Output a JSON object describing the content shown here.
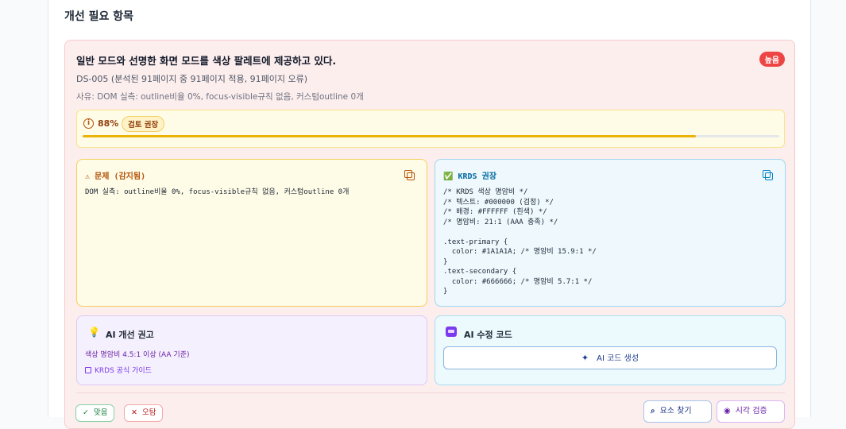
{
  "section": {
    "title": "개선 필요 항목"
  },
  "issue": {
    "title": "일반 모드와 선명한 화면 모드를 색상 팔레트에 제공하고 있다.",
    "severity": "높음",
    "id_line": "DS-005 (분석된 91페이지 중 91페이지 적용, 91페이지 오류)",
    "reason": "사유: DOM 실측: outline비율 0%, focus-visible규칙 없음, 커스텀outline 0개"
  },
  "confidence": {
    "value": "88%",
    "percent": 88,
    "badge": "검토 권장"
  },
  "problem": {
    "title": "⚠ 문제 (감지됨)",
    "code": "DOM 실측: outline비율 0%, focus-visible규칙 없음, 커스텀outline 0개"
  },
  "krds": {
    "title": "✅ KRDS 권장",
    "code": "/* KRDS 색상 명암비 */\n/* 텍스트: #000000 (검정) */\n/* 배경: #FFFFFF (흰색) */\n/* 명암비: 21:1 (AAA 충족) */\n\n.text-primary {\n  color: #1A1A1A; /* 명암비 15.9:1 */\n}\n.text-secondary {\n  color: #666666; /* 명암비 5.7:1 */\n}"
  },
  "ai_advice": {
    "title": "AI 개선 권고",
    "desc": "색상 명암비 4.5:1 이상 (AA 기준)",
    "link": "KRDS 공식 가이드"
  },
  "ai_fix": {
    "title": "AI 수정 코드",
    "button": "AI 코드 생성"
  },
  "actions": {
    "correct": "맞음",
    "wrong": "오탐",
    "find": "요소 찾기",
    "visual": "시각 검증"
  },
  "colors": {
    "severity": "#ef4444",
    "progress": "#eab308",
    "accent": "#7c3aed"
  }
}
